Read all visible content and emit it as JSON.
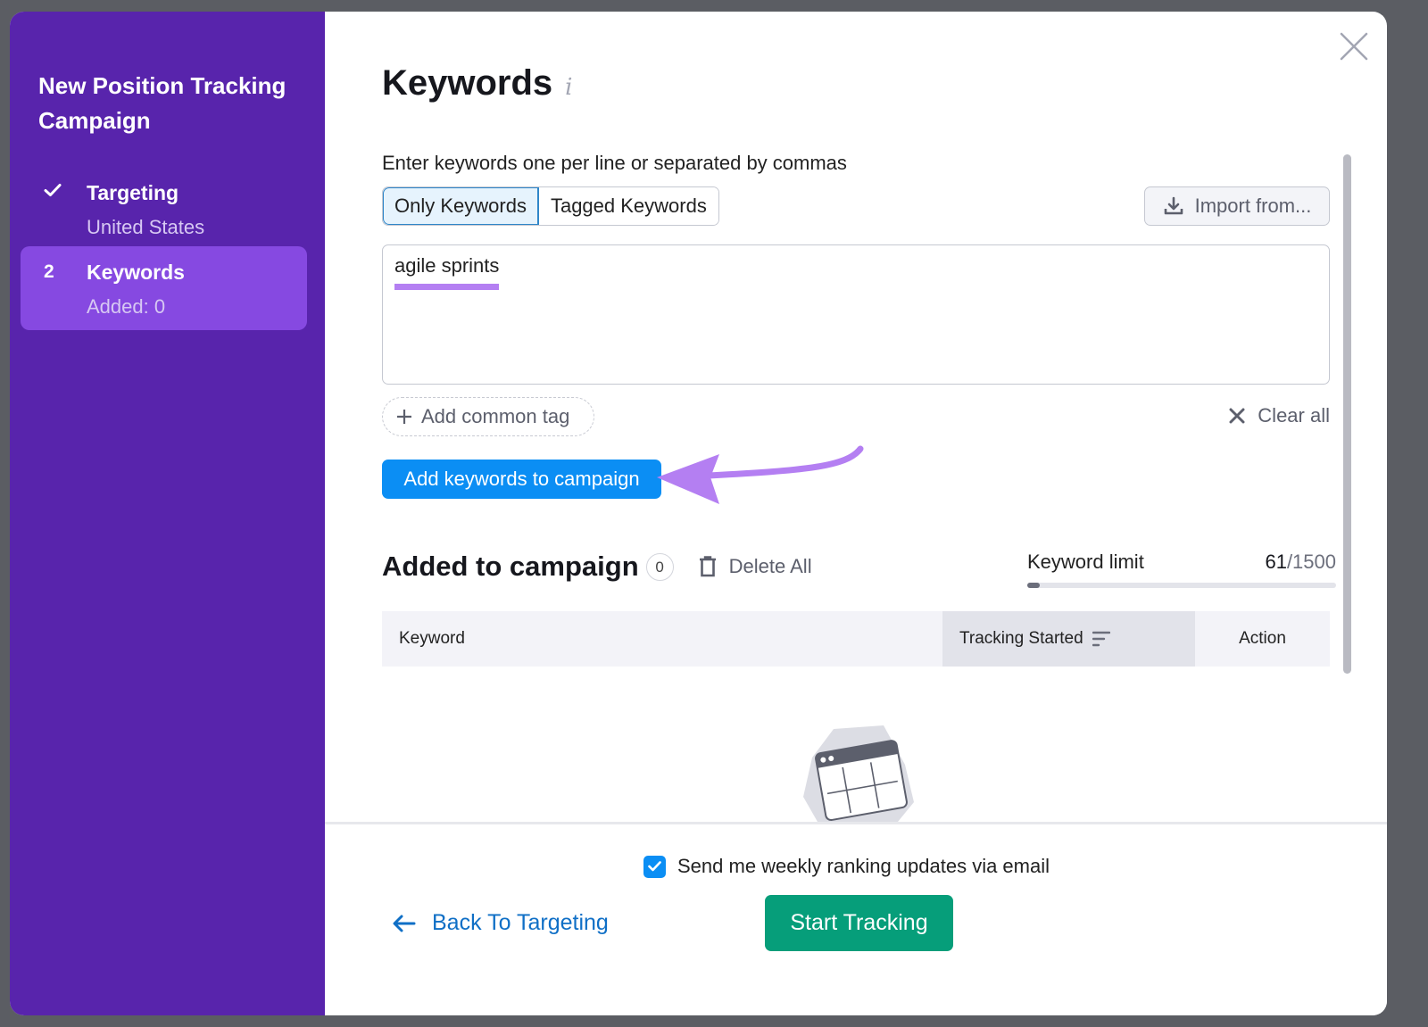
{
  "sidebar": {
    "title": "New Position Tracking Campaign",
    "steps": [
      {
        "marker": "check-icon",
        "label": "Targeting",
        "sub": "United States",
        "state": "done"
      },
      {
        "marker": "2",
        "label": "Keywords",
        "sub": "Added: 0",
        "state": "active"
      }
    ]
  },
  "main": {
    "title": "Keywords",
    "info_icon": "i",
    "hint": "Enter keywords one per line or separated by commas",
    "tabs": [
      {
        "label": "Only Keywords",
        "active": true
      },
      {
        "label": "Tagged Keywords",
        "active": false
      }
    ],
    "import_label": "Import from...",
    "keywords_value": "agile sprints",
    "add_tag_label": "Add common tag",
    "clear_all_label": "Clear all",
    "add_button_label": "Add keywords to campaign",
    "added_section": {
      "title": "Added to campaign",
      "count": "0",
      "delete_all_label": "Delete All"
    },
    "keyword_limit": {
      "label": "Keyword limit",
      "used": "61",
      "total": "/1500",
      "used_fraction": 0.0407
    },
    "table": {
      "columns": [
        "Keyword",
        "Tracking Started",
        "Action"
      ]
    }
  },
  "footer": {
    "email_checkbox_label": "Send me weekly ranking updates via email",
    "email_checked": true,
    "back_label": "Back To Targeting",
    "start_label": "Start Tracking"
  },
  "colors": {
    "sidebar_bg": "#5824ac",
    "sidebar_active": "#8649e1",
    "primary_blue": "#0b8ef4",
    "start_green": "#069e7a",
    "annotation_purple": "#b47ff2",
    "link_blue": "#0f6fc6"
  }
}
